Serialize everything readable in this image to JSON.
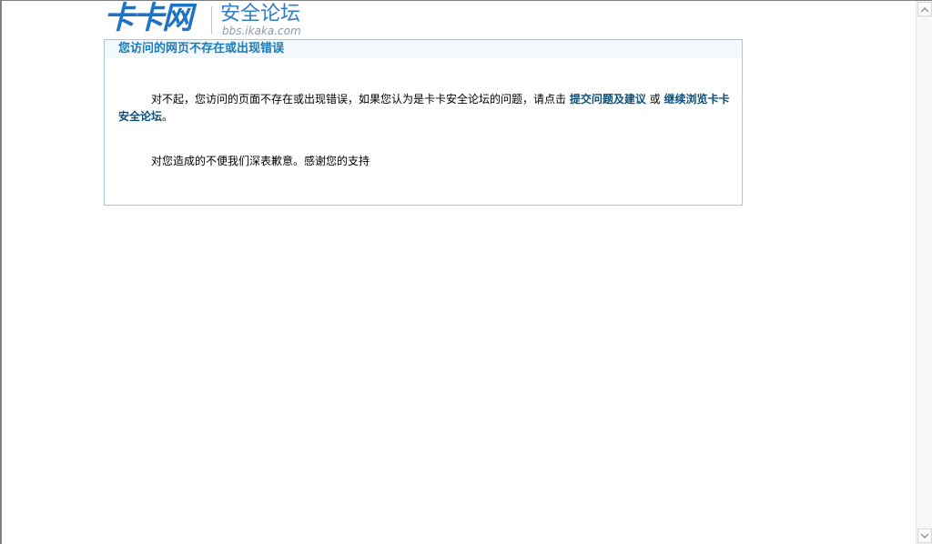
{
  "logo": {
    "mark": "卡卡网",
    "title": "安全论坛",
    "subtitle": "bbs.ikaka.com"
  },
  "message": {
    "title": "您访问的网页不存在或出现错误",
    "para1_text": "对不起，您访问的页面不存在或出现错误，如果您认为是卡卡安全论坛的问题，请点击 ",
    "link_report": "提交问题及建议",
    "or_text": " 或 ",
    "link_continue": "继续浏览卡卡安全论坛",
    "para1_end": "。",
    "para2_text": "对您造成的不便我们深表歉意。感谢您的支持"
  },
  "scrollbar": {
    "up_icon": "scroll-up-arrow",
    "down_icon": "scroll-down-arrow"
  }
}
